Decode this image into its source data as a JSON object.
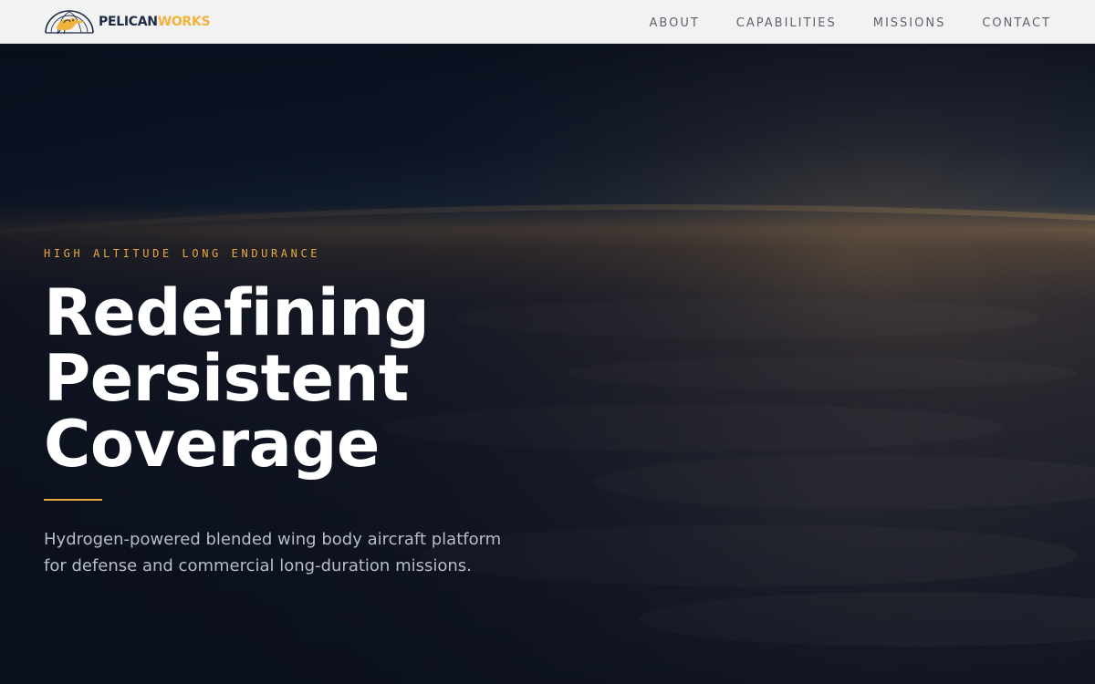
{
  "nav": {
    "logo": {
      "word1": "PELICAN",
      "word2": "WORKS",
      "icon": "pelican-logo-icon"
    },
    "links": [
      {
        "label": "ABOUT"
      },
      {
        "label": "CAPABILITIES"
      },
      {
        "label": "MISSIONS"
      },
      {
        "label": "CONTACT"
      }
    ]
  },
  "hero": {
    "eyebrow": "HIGH ALTITUDE LONG ENDURANCE",
    "headline": [
      "Redefining",
      "Persistent",
      "Coverage"
    ],
    "lede_lines": [
      "Hydrogen-powered blended wing body aircraft platform",
      "for defense and commercial long-duration missions."
    ],
    "background": "earth-horizon-at-dusk-from-high-altitude"
  },
  "colors": {
    "accent": "#e6a842",
    "navy": "#1d2a44",
    "nav_bg": "#f2f2f2",
    "hero_bg": "#0b1120",
    "text_muted": "#b7bdc8"
  }
}
